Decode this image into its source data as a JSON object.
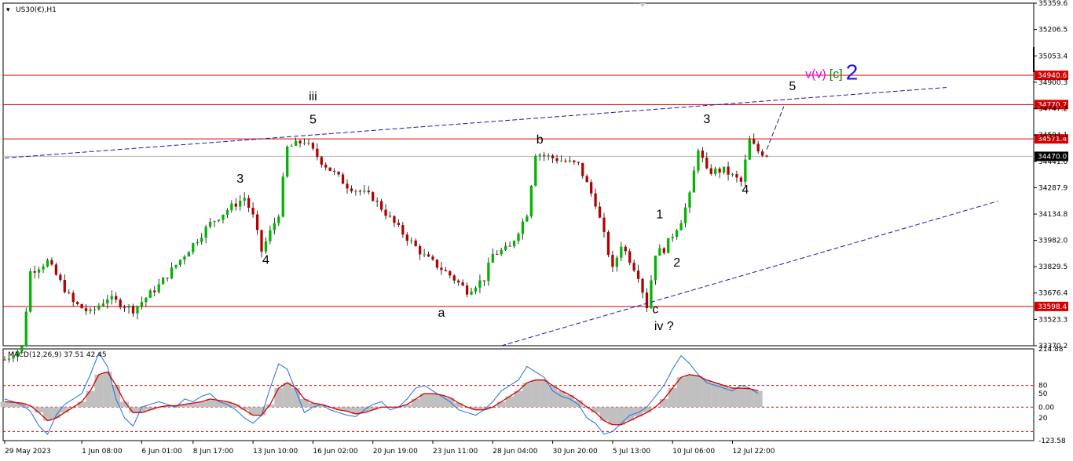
{
  "header": {
    "symbol": "US30(€),H1",
    "indicator": "MACD(12,26,9) 37.51 42.45"
  },
  "colors": {
    "candle_up": "#00b400",
    "candle_down": "#b40000",
    "wick": "#000000",
    "level_line": "#d40000",
    "trend_line": "#1a1aaa",
    "macd_line": "#1e6ee6",
    "signal_line": "#d40000",
    "histogram": "#c0c0c0",
    "wave_magenta": "#e600e6",
    "wave_green": "#0a8a0a",
    "wave_blue": "#1a1ae6",
    "current_price_box": "#000000"
  },
  "chart_data": [
    {
      "type": "candlestick",
      "title": "US30(€),H1",
      "y_ticks": [
        "35359.6",
        "35206.5",
        "35053.4",
        "34900.3",
        "34747.2",
        "34594.1",
        "34441.0",
        "34287.9",
        "34134.8",
        "33982.0",
        "33829.5",
        "33676.4",
        "33523.3",
        "33370.2"
      ],
      "ylim": [
        33370.2,
        35359.6
      ],
      "x_ticks": [
        "29 May 2023",
        "1 Jun 08:00",
        "6 Jun 01:00",
        "8 Jun 17:00",
        "13 Jun 10:00",
        "16 Jun 02:00",
        "20 Jun 19:00",
        "23 Jun 11:00",
        "28 Jun 04:00",
        "30 Jun 20:00",
        "5 Jul 13:00",
        "10 Jul 06:00",
        "12 Jul 22:00"
      ],
      "price_path": [
        [
          0,
          33290
        ],
        [
          2,
          33360
        ],
        [
          3,
          33800
        ],
        [
          5,
          33860
        ],
        [
          8,
          33620
        ],
        [
          10,
          33560
        ],
        [
          12,
          33650
        ],
        [
          15,
          33580
        ],
        [
          18,
          33720
        ],
        [
          21,
          33900
        ],
        [
          24,
          34080
        ],
        [
          26,
          34160
        ],
        [
          28,
          34230
        ],
        [
          29,
          34120
        ],
        [
          30,
          33920
        ],
        [
          32,
          34140
        ],
        [
          33,
          34520
        ],
        [
          35,
          34560
        ],
        [
          37,
          34440
        ],
        [
          40,
          34300
        ],
        [
          43,
          34230
        ],
        [
          46,
          34050
        ],
        [
          49,
          33890
        ],
        [
          52,
          33780
        ],
        [
          54,
          33690
        ],
        [
          56,
          33760
        ],
        [
          57,
          33900
        ],
        [
          59,
          33940
        ],
        [
          61,
          34140
        ],
        [
          62,
          34490
        ],
        [
          64,
          34460
        ],
        [
          67,
          34420
        ],
        [
          69,
          34200
        ],
        [
          70,
          34010
        ],
        [
          71,
          33810
        ],
        [
          72,
          33960
        ],
        [
          73,
          33870
        ],
        [
          74,
          33780
        ],
        [
          75,
          33600
        ],
        [
          76,
          33910
        ],
        [
          77,
          33930
        ],
        [
          79,
          34100
        ],
        [
          80,
          34240
        ],
        [
          81,
          34520
        ],
        [
          82,
          34380
        ],
        [
          84,
          34390
        ],
        [
          86,
          34320
        ],
        [
          87,
          34560
        ],
        [
          88,
          34500
        ],
        [
          89,
          34480
        ]
      ],
      "levels": [
        {
          "label": "34940.6",
          "value": 34940.6
        },
        {
          "label": "34770.7",
          "value": 34770.7
        },
        {
          "label": "34571.4",
          "value": 34571.4
        },
        {
          "label": "33598.4",
          "value": 33598.4
        }
      ],
      "current_price": {
        "label": "34470.0",
        "value": 34470.0
      },
      "trendlines": [
        {
          "style": "dashed",
          "from": [
            0,
            34460
          ],
          "to": [
            110,
            34870
          ]
        },
        {
          "style": "dashed",
          "from": [
            58,
            33370
          ],
          "to": [
            116,
            34210
          ]
        },
        {
          "style": "dashed",
          "from": [
            89,
            34510
          ],
          "to": [
            91,
            34760
          ]
        }
      ],
      "wave_labels": [
        {
          "text": "iii",
          "color": "magenta",
          "x": 36,
          "y": 34795
        },
        {
          "text": "5",
          "color": "black",
          "x": 36,
          "y": 34660
        },
        {
          "text": "3",
          "color": "black",
          "x": 27.5,
          "y": 34318
        },
        {
          "text": "4",
          "color": "black",
          "x": 30.5,
          "y": 33846
        },
        {
          "text": "b",
          "color": "black",
          "x": 62.5,
          "y": 34545
        },
        {
          "text": "a",
          "color": "black",
          "x": 51,
          "y": 33538
        },
        {
          "text": "3",
          "color": "black",
          "x": 82,
          "y": 34663
        },
        {
          "text": "4",
          "color": "black",
          "x": 86.5,
          "y": 34253
        },
        {
          "text": "1",
          "color": "black",
          "x": 76.5,
          "y": 34110
        },
        {
          "text": "2",
          "color": "black",
          "x": 78.5,
          "y": 33829
        },
        {
          "text": "c",
          "color": "black",
          "x": 76,
          "y": 33560
        },
        {
          "text": "iv ?",
          "color": "magenta",
          "x": 77,
          "y": 33462
        },
        {
          "text": "5",
          "color": "black",
          "x": 92,
          "y": 34855
        }
      ],
      "target_label": {
        "x": 93.5,
        "y": 34925,
        "parts": [
          {
            "text": "v(v)",
            "color": "magenta"
          },
          {
            "text": "[c]",
            "color": "green"
          },
          {
            "text": "2",
            "color": "blue"
          }
        ]
      }
    },
    {
      "type": "line",
      "title": "MACD(12,26,9) 37.51 42.45",
      "y_ticks": [
        "214.88",
        "80",
        "50",
        "0.00",
        "20",
        "-123.58"
      ],
      "ylim": [
        -123.58,
        214.88
      ],
      "levels": [
        80,
        0,
        -90
      ],
      "series": [
        {
          "values": [
            30,
            20,
            8,
            -15,
            -70,
            -100,
            -30,
            10,
            30,
            50,
            120,
            200,
            150,
            30,
            -40,
            -70,
            0,
            10,
            20,
            10,
            0,
            30,
            20,
            40,
            50,
            20,
            10,
            -10,
            -40,
            -60,
            -30,
            70,
            160,
            140,
            60,
            -20,
            0,
            10,
            -10,
            -20,
            -30,
            -35,
            -10,
            10,
            20,
            -10,
            0,
            30,
            70,
            80,
            60,
            40,
            20,
            -10,
            -20,
            -30,
            -10,
            20,
            60,
            80,
            100,
            150,
            130,
            110,
            60,
            40,
            30,
            10,
            -40,
            -60,
            -100,
            -90,
            -60,
            -30,
            -20,
            0,
            40,
            80,
            140,
            190,
            160,
            120,
            90,
            80,
            70,
            60,
            80,
            70,
            50
          ]
        },
        {
          "values": [
            20,
            18,
            15,
            5,
            -20,
            -50,
            -40,
            -20,
            0,
            20,
            60,
            120,
            130,
            80,
            20,
            -20,
            -20,
            -10,
            0,
            5,
            5,
            10,
            15,
            20,
            30,
            25,
            20,
            10,
            -10,
            -30,
            -30,
            10,
            70,
            90,
            70,
            30,
            15,
            10,
            0,
            -10,
            -15,
            -25,
            -20,
            -10,
            0,
            0,
            0,
            10,
            30,
            50,
            50,
            45,
            35,
            15,
            0,
            -10,
            -10,
            0,
            20,
            40,
            60,
            90,
            100,
            100,
            80,
            60,
            45,
            25,
            0,
            -20,
            -50,
            -65,
            -65,
            -50,
            -35,
            -20,
            0,
            30,
            70,
            110,
            120,
            115,
            100,
            90,
            80,
            70,
            70,
            68,
            60
          ]
        }
      ]
    }
  ],
  "x_labels": [
    {
      "text": "29 May 2023",
      "i": 0
    },
    {
      "text": "1 Jun 08:00",
      "i": 9
    },
    {
      "text": "6 Jun 01:00",
      "i": 16
    },
    {
      "text": "8 Jun 17:00",
      "i": 22
    },
    {
      "text": "13 Jun 10:00",
      "i": 29
    },
    {
      "text": "16 Jun 02:00",
      "i": 36
    },
    {
      "text": "20 Jun 19:00",
      "i": 43
    },
    {
      "text": "23 Jun 11:00",
      "i": 50
    },
    {
      "text": "28 Jun 04:00",
      "i": 57
    },
    {
      "text": "30 Jun 20:00",
      "i": 64
    },
    {
      "text": "5 Jul 13:00",
      "i": 71
    },
    {
      "text": "10 Jul 06:00",
      "i": 78
    },
    {
      "text": "12 Jul 22:00",
      "i": 85
    }
  ]
}
